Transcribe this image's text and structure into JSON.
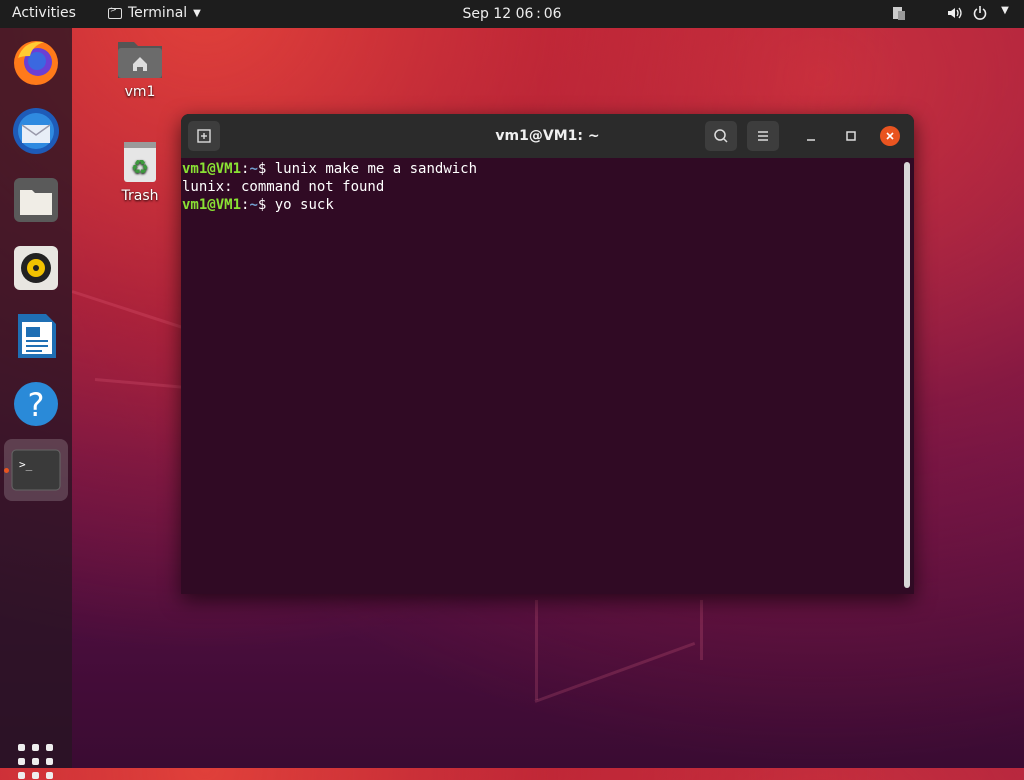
{
  "topbar": {
    "activities": "Activities",
    "app_name": "Terminal",
    "clock": "Sep 12  06 : 06"
  },
  "desktop": {
    "icons": [
      {
        "label": "vm1"
      },
      {
        "label": "Trash"
      }
    ]
  },
  "dock": {
    "apps": [
      "firefox",
      "thunderbird",
      "files",
      "rhythmbox",
      "libreoffice-writer",
      "help",
      "terminal"
    ]
  },
  "terminal": {
    "title": "vm1@VM1: ~",
    "lines": [
      {
        "user": "vm1@VM1",
        "sep": ":",
        "path": "~",
        "prompt": "$ ",
        "cmd": "lunix make me a sandwich"
      },
      {
        "output": "lunix: command not found"
      },
      {
        "user": "vm1@VM1",
        "sep": ":",
        "path": "~",
        "prompt": "$ ",
        "cmd": "yo suck"
      }
    ]
  },
  "colors": {
    "accent": "#e95420",
    "terminal_bg": "#300a24",
    "prompt_user": "#8ae234",
    "prompt_path": "#729fcf"
  }
}
